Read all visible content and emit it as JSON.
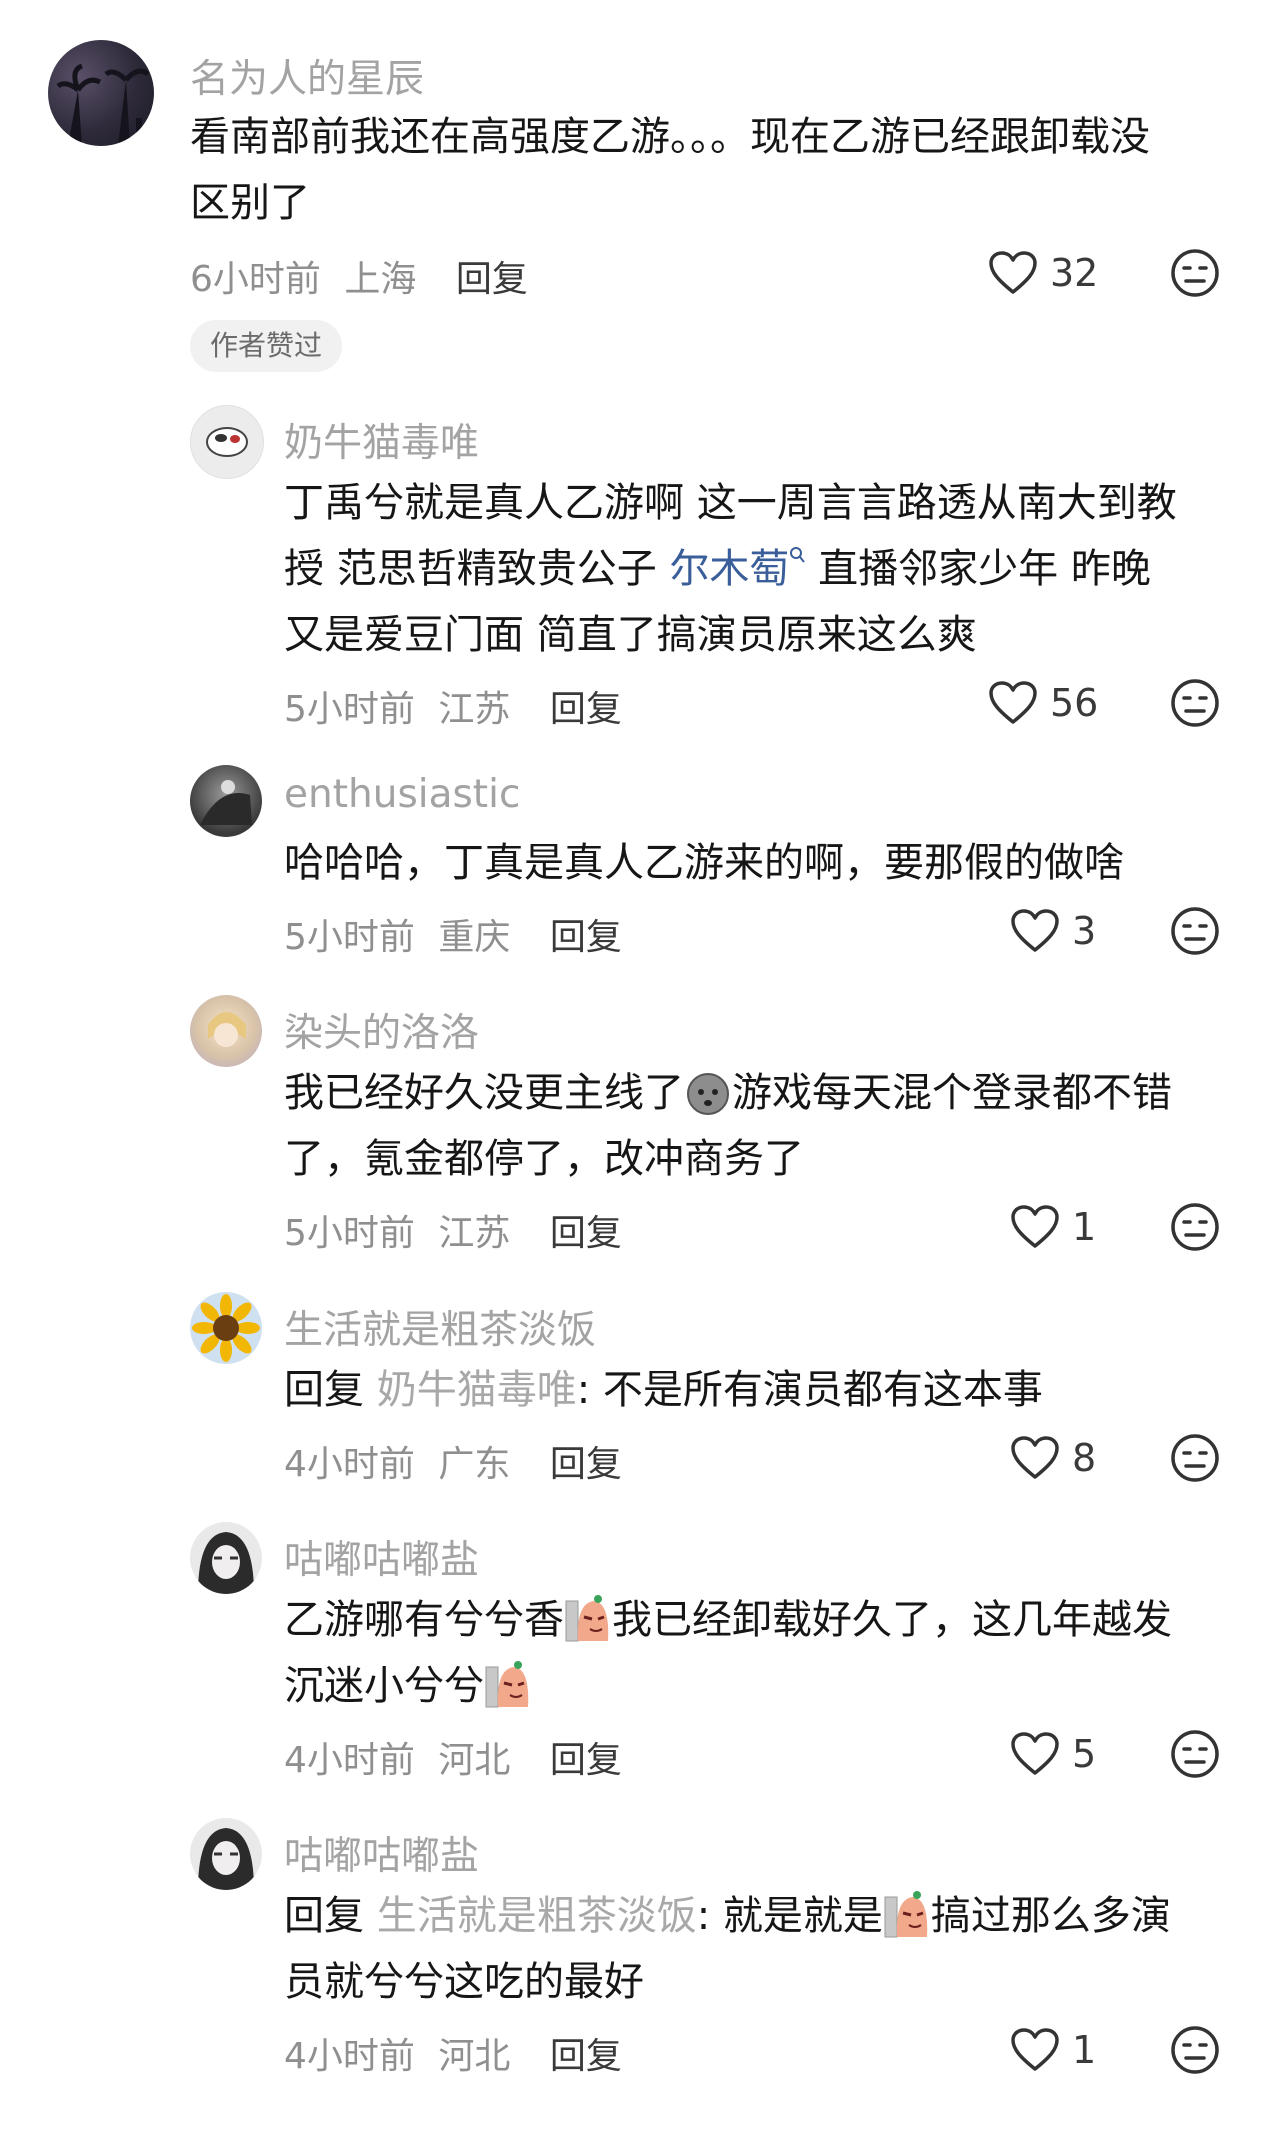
{
  "comments": [
    {
      "user": "名为人的星辰",
      "lines": [
        "看南部前我还在高强度乙游。。。现在乙游已经跟卸载没",
        "区别了"
      ],
      "time": "6小时前",
      "location": "上海",
      "reply_label": "回复",
      "likes": "32",
      "badge": "作者赞过"
    },
    {
      "user": "奶牛猫毒唯",
      "line1": "丁禹兮就是真人乙游啊  这一周言言路透从南大到教",
      "line2_a": "授  范思哲精致贵公子  ",
      "line2_link": "尔木萄",
      "line2_b": " 直播邻家少年  昨晚",
      "line3": "又是爱豆门面  简直了搞演员原来这么爽",
      "time": "5小时前",
      "location": "江苏",
      "reply_label": "回复",
      "likes": "56"
    },
    {
      "user": "enthusiastic",
      "line1": "哈哈哈，丁真是真人乙游来的啊，要那假的做啥",
      "time": "5小时前",
      "location": "重庆",
      "reply_label": "回复",
      "likes": "3"
    },
    {
      "user": "染头的洛洛",
      "line1_a": "我已经好久没更主线了",
      "line1_b": "游戏每天混个登录都不错",
      "line2": "了，氪金都停了，改冲商务了",
      "time": "5小时前",
      "location": "江苏",
      "reply_label": "回复",
      "likes": "1"
    },
    {
      "user": "生活就是粗茶淡饭",
      "reply_prefix": "回复 ",
      "mention": "奶牛猫毒唯",
      "body": ": 不是所有演员都有这本事",
      "time": "4小时前",
      "location": "广东",
      "reply_label": "回复",
      "likes": "8"
    },
    {
      "user": "咕嘟咕嘟盐",
      "line1_a": "乙游哪有兮兮香",
      "line1_b": "我已经卸载好久了，这几年越发",
      "line2": "沉迷小兮兮",
      "time": "4小时前",
      "location": "河北",
      "reply_label": "回复",
      "likes": "5"
    },
    {
      "user": "咕嘟咕嘟盐",
      "reply_prefix": "回复 ",
      "mention": "生活就是粗茶淡饭",
      "body_a": ": 就是就是",
      "body_b": "搞过那么多演",
      "line2": "员就兮兮这吃的最好",
      "time": "4小时前",
      "location": "河北",
      "reply_label": "回复",
      "likes": "1"
    }
  ],
  "colors": {
    "text": "#161616",
    "meta": "#8f8f8f",
    "name": "#a3a3a3",
    "link": "#3a5e99"
  },
  "icons": [
    "heart-outline-icon",
    "dislike-face-icon",
    "search-icon",
    "emoji-sticker"
  ]
}
